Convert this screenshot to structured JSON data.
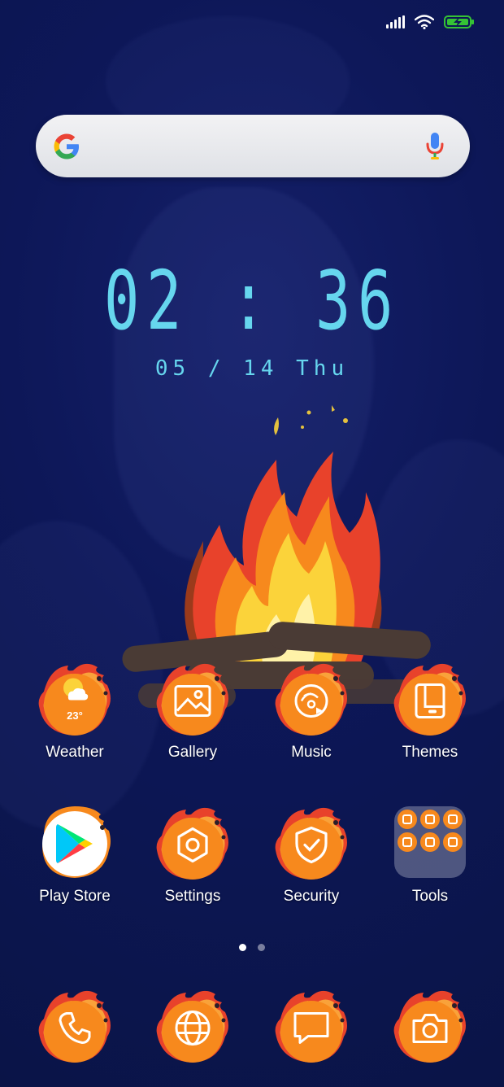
{
  "status_bar": {
    "icons": [
      "signal-icon",
      "wifi-icon",
      "battery-charging-icon"
    ],
    "colors": {
      "battery": "#35c235"
    }
  },
  "search": {
    "icons": [
      "google-logo-icon",
      "microphone-icon"
    ]
  },
  "clock": {
    "time": "02 : 36",
    "date": "05 / 14  Thu"
  },
  "theme_colors": {
    "clock": "#66d6ee",
    "icon_orange": "#f7891d",
    "flame_red": "#e8422b"
  },
  "apps": [
    {
      "label": "Weather",
      "icon": "weather-sun-cloud-icon",
      "value": "23°"
    },
    {
      "label": "Gallery",
      "icon": "image-icon"
    },
    {
      "label": "Music",
      "icon": "music-disc-icon"
    },
    {
      "label": "Themes",
      "icon": "themes-icon"
    },
    {
      "label": "Play Store",
      "icon": "play-store-icon"
    },
    {
      "label": "Settings",
      "icon": "gear-hexagon-icon"
    },
    {
      "label": "Security",
      "icon": "shield-check-icon"
    },
    {
      "label": "Tools",
      "icon": "folder-icon"
    }
  ],
  "page_indicator": {
    "pages": 2,
    "active": 1
  },
  "dock": [
    {
      "icon": "phone-icon"
    },
    {
      "icon": "browser-globe-icon"
    },
    {
      "icon": "messages-icon"
    },
    {
      "icon": "camera-icon"
    }
  ]
}
